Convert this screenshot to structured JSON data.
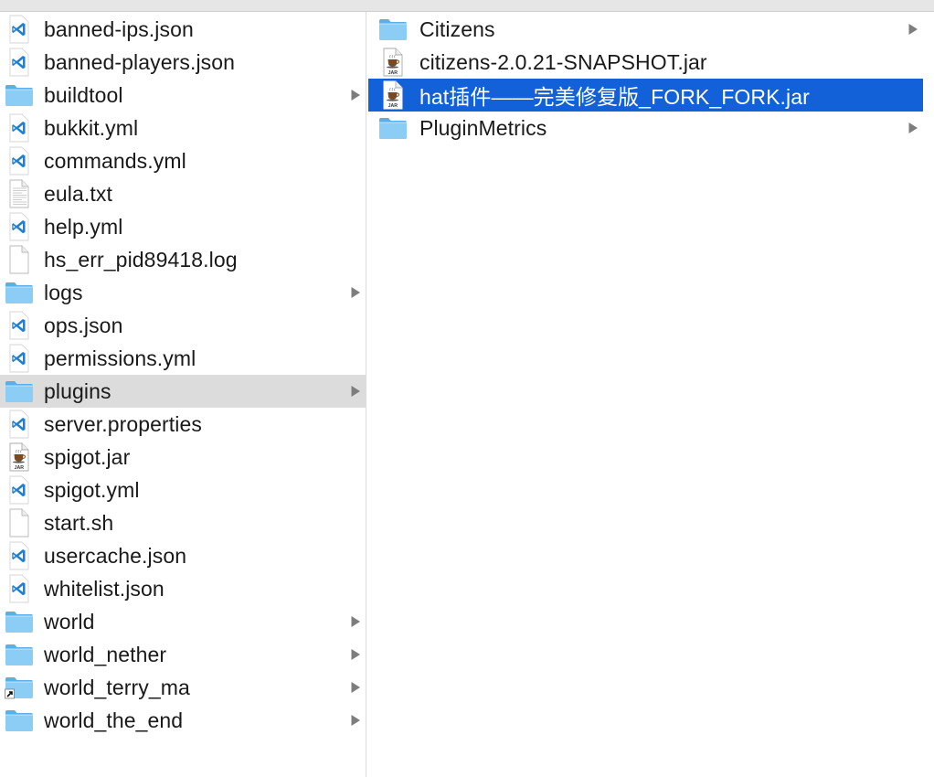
{
  "window": {
    "accent_selected": "#1261d9",
    "inactive_selected": "#dcdcdc"
  },
  "column1": {
    "items": [
      {
        "name": "banned-ips.json",
        "icon": "vscode-file-icon",
        "folder": false,
        "selected": ""
      },
      {
        "name": "banned-players.json",
        "icon": "vscode-file-icon",
        "folder": false,
        "selected": ""
      },
      {
        "name": "buildtool",
        "icon": "folder-icon",
        "folder": true,
        "selected": ""
      },
      {
        "name": "bukkit.yml",
        "icon": "vscode-file-icon",
        "folder": false,
        "selected": ""
      },
      {
        "name": "commands.yml",
        "icon": "vscode-file-icon",
        "folder": false,
        "selected": ""
      },
      {
        "name": "eula.txt",
        "icon": "text-file-icon",
        "folder": false,
        "selected": ""
      },
      {
        "name": "help.yml",
        "icon": "vscode-file-icon",
        "folder": false,
        "selected": ""
      },
      {
        "name": "hs_err_pid89418.log",
        "icon": "blank-file-icon",
        "folder": false,
        "selected": ""
      },
      {
        "name": "logs",
        "icon": "folder-icon",
        "folder": true,
        "selected": ""
      },
      {
        "name": "ops.json",
        "icon": "vscode-file-icon",
        "folder": false,
        "selected": ""
      },
      {
        "name": "permissions.yml",
        "icon": "vscode-file-icon",
        "folder": false,
        "selected": ""
      },
      {
        "name": "plugins",
        "icon": "folder-icon",
        "folder": true,
        "selected": "inactive"
      },
      {
        "name": "server.properties",
        "icon": "vscode-file-icon",
        "folder": false,
        "selected": ""
      },
      {
        "name": "spigot.jar",
        "icon": "jar-file-icon",
        "folder": false,
        "selected": ""
      },
      {
        "name": "spigot.yml",
        "icon": "vscode-file-icon",
        "folder": false,
        "selected": ""
      },
      {
        "name": "start.sh",
        "icon": "blank-file-icon",
        "folder": false,
        "selected": ""
      },
      {
        "name": "usercache.json",
        "icon": "vscode-file-icon",
        "folder": false,
        "selected": ""
      },
      {
        "name": "whitelist.json",
        "icon": "vscode-file-icon",
        "folder": false,
        "selected": ""
      },
      {
        "name": "world",
        "icon": "folder-icon",
        "folder": true,
        "selected": ""
      },
      {
        "name": "world_nether",
        "icon": "folder-icon",
        "folder": true,
        "selected": ""
      },
      {
        "name": "world_terry_ma",
        "icon": "folder-alias-icon",
        "folder": true,
        "selected": ""
      },
      {
        "name": "world_the_end",
        "icon": "folder-icon",
        "folder": true,
        "selected": ""
      }
    ]
  },
  "column2": {
    "items": [
      {
        "name": "Citizens",
        "icon": "folder-icon",
        "folder": true,
        "selected": ""
      },
      {
        "name": "citizens-2.0.21-SNAPSHOT.jar",
        "icon": "jar-file-icon",
        "folder": false,
        "selected": ""
      },
      {
        "name": "hat插件——完美修复版_FORK_FORK.jar",
        "icon": "jar-file-icon",
        "folder": false,
        "selected": "active"
      },
      {
        "name": "PluginMetrics",
        "icon": "folder-icon",
        "folder": true,
        "selected": ""
      }
    ]
  },
  "icons": {
    "jar_label": "JAR"
  }
}
